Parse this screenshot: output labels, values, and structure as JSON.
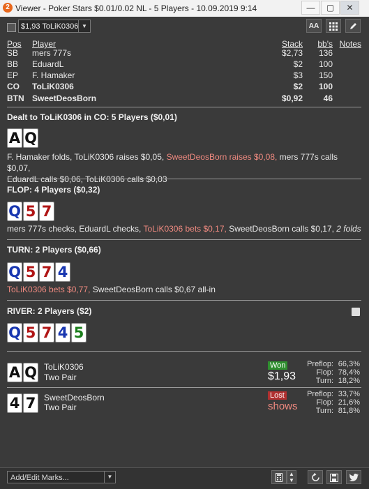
{
  "window": {
    "logo": "2",
    "title": "Viewer - Poker Stars $0.01/0.02 NL - 5 Players - 10.09.2019 9:14",
    "minimize": "—",
    "maximize": "▢",
    "close": "✕"
  },
  "toolbar": {
    "hand_select": "$1,93 ToLiK0306",
    "font_button": "AA"
  },
  "players_table": {
    "headers": {
      "pos": "Pos",
      "player": "Player",
      "stack": "Stack",
      "bbs": "bb's",
      "notes": "Notes"
    },
    "rows": [
      {
        "pos": "SB",
        "player": "mers 777s",
        "stack": "$2,73",
        "bbs": "136"
      },
      {
        "pos": "BB",
        "player": "EduardL",
        "stack": "$2",
        "bbs": "100"
      },
      {
        "pos": "EP",
        "player": "F. Hamaker",
        "stack": "$3",
        "bbs": "150"
      },
      {
        "pos": "CO",
        "player": "ToLiK0306",
        "stack": "$2",
        "bbs": "100"
      },
      {
        "pos": "BTN",
        "player": "SweetDeosBorn",
        "stack": "$0,92",
        "bbs": "46"
      }
    ]
  },
  "preflop": {
    "title": "Dealt to ToLiK0306 in CO: 5 Players ($0,01)",
    "cards": [
      {
        "rank": "A",
        "suit": "s"
      },
      {
        "rank": "Q",
        "suit": "s"
      }
    ],
    "line1_a": "F. Hamaker folds, ToLiK0306 raises $0,05, ",
    "line1_b": "SweetDeosBorn raises $0,08,",
    "line1_c": " mers 777s calls $0,07,",
    "line2": "EduardL calls $0,06, ToLiK0306 calls $0,03"
  },
  "flop": {
    "title": "FLOP: 4 Players ($0,32)",
    "cards": [
      {
        "rank": "Q",
        "suit": "d"
      },
      {
        "rank": "5",
        "suit": "h"
      },
      {
        "rank": "7",
        "suit": "h"
      }
    ],
    "text_a": "mers 777s checks, EduardL checks, ",
    "text_b": "ToLiK0306 bets $0,17,",
    "text_c": " SweetDeosBorn calls $0,17, ",
    "text_d": "2 folds"
  },
  "turn": {
    "title": "TURN: 2 Players ($0,66)",
    "cards": [
      {
        "rank": "Q",
        "suit": "d"
      },
      {
        "rank": "5",
        "suit": "h"
      },
      {
        "rank": "7",
        "suit": "h"
      },
      {
        "rank": "4",
        "suit": "d"
      }
    ],
    "text_a": "ToLiK0306 bets $0,77,",
    "text_b": " SweetDeosBorn calls $0,67 all-in"
  },
  "river": {
    "title": "RIVER: 2 Players ($2)",
    "cards": [
      {
        "rank": "Q",
        "suit": "d"
      },
      {
        "rank": "5",
        "suit": "h"
      },
      {
        "rank": "7",
        "suit": "h"
      },
      {
        "rank": "4",
        "suit": "d"
      },
      {
        "rank": "5",
        "suit": "c"
      }
    ]
  },
  "summary": [
    {
      "cards": [
        {
          "rank": "A",
          "suit": "s"
        },
        {
          "rank": "Q",
          "suit": "s"
        }
      ],
      "name": "ToLiK0306",
      "hand": "Two Pair",
      "result": "Won",
      "amount": "$1,93",
      "stats": [
        {
          "label": "Preflop:",
          "value": "66,3%"
        },
        {
          "label": "Flop:",
          "value": "78,4%"
        },
        {
          "label": "Turn:",
          "value": "18,2%"
        }
      ]
    },
    {
      "cards": [
        {
          "rank": "4",
          "suit": "s"
        },
        {
          "rank": "7",
          "suit": "s"
        }
      ],
      "name": "SweetDeosBorn",
      "hand": "Two Pair",
      "result": "Lost",
      "amount": "shows",
      "stats": [
        {
          "label": "Preflop:",
          "value": "33,7%"
        },
        {
          "label": "Flop:",
          "value": "21,6%"
        },
        {
          "label": "Turn:",
          "value": "81,8%"
        }
      ]
    }
  ],
  "bottom": {
    "marks_placeholder": "Add/Edit Marks..."
  },
  "colors": {
    "highlight": "#f08a80",
    "won": "#2f8f2f",
    "lost": "#b13030"
  },
  "icons": [
    "checkbox-icon",
    "grid-icon",
    "pencil-icon",
    "note-icon",
    "calculator-icon",
    "replay-icon",
    "save-icon",
    "twitter-icon"
  ]
}
